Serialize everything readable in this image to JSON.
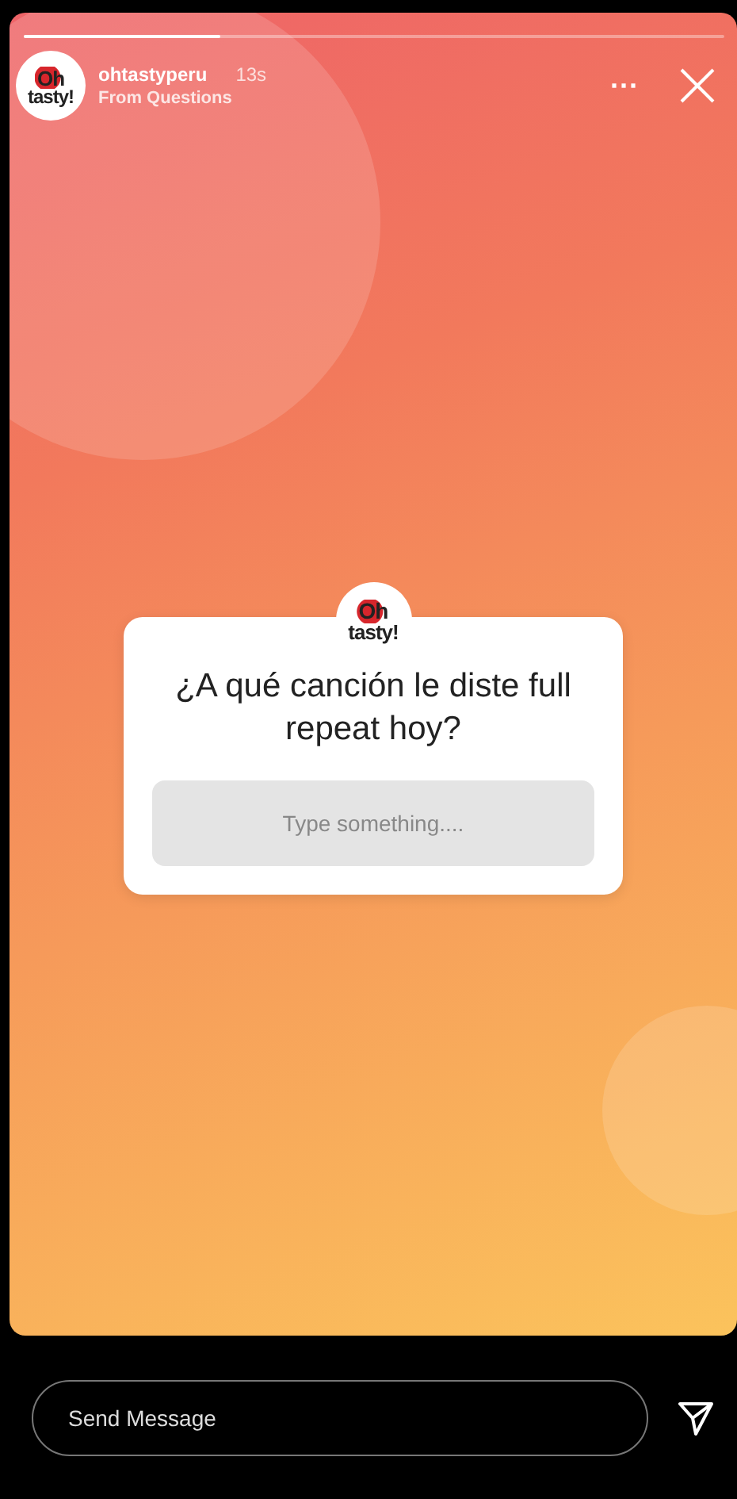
{
  "progress": {
    "level": 0.28
  },
  "header": {
    "avatar_logo": {
      "top": "Oh",
      "bottom": "tasty!"
    },
    "username": "ohtastyperu",
    "time": "13s",
    "subtitle": "From Questions",
    "more": "···"
  },
  "sticker": {
    "logo": {
      "top": "Oh",
      "bottom": "tasty!"
    },
    "question": "¿A qué canción le diste full repeat hoy?",
    "answer": {
      "placeholder": "Type something...."
    }
  },
  "footer": {
    "message": {
      "placeholder": "Send Message"
    }
  }
}
